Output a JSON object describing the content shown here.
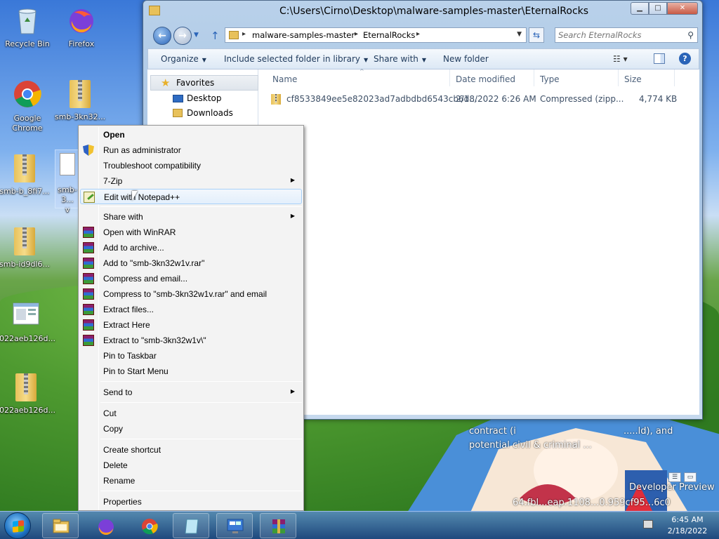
{
  "desktop": {
    "icons": [
      {
        "label": "Recycle Bin"
      },
      {
        "label": "Firefox"
      },
      {
        "label": "Google Chrome"
      },
      {
        "label": "smb-3kn32..."
      },
      {
        "label": "smb-b_8fi7..."
      },
      {
        "label": "smb-3..."
      },
      {
        "label": "v"
      },
      {
        "label": "smb-id9dl6..."
      },
      {
        "label": "022aeb126d..."
      },
      {
        "label": "022aeb126d..."
      }
    ],
    "wallpaper_text": [
      "contract (i",
      ".....ld), and",
      "potential civil & criminal ...",
      "Developer Preview",
      "64.fbl...eap.1108...0.959cf95...6c0"
    ]
  },
  "window": {
    "title": "C:\\Users\\Cirno\\Desktop\\malware-samples-master\\EternalRocks",
    "caption_buttons": {
      "minimize": "▁",
      "maximize": "□",
      "close": "✕"
    },
    "address": {
      "segments": [
        "malware-samples-master",
        "EternalRocks"
      ],
      "sep": "▸"
    },
    "search_placeholder": "Search EternalRocks",
    "toolbar": {
      "organize": "Organize",
      "include": "Include selected folder in library",
      "share": "Share with",
      "new_folder": "New folder"
    },
    "nav": {
      "favorites": "Favorites",
      "items": [
        "Desktop",
        "Downloads"
      ]
    },
    "columns": {
      "name": "Name",
      "date": "Date modified",
      "type": "Type",
      "size": "Size"
    },
    "files": [
      {
        "name": "cf8533849ee5e82023ad7adbdbd6543cb6d...",
        "date": "2/18/2022 6:26 AM",
        "type": "Compressed (zipp...",
        "size": "4,774 KB"
      }
    ]
  },
  "context_menu": {
    "items": [
      {
        "label": "Open",
        "bold": true
      },
      {
        "label": "Run as administrator",
        "icon": "shield-icon"
      },
      {
        "label": "Troubleshoot compatibility"
      },
      {
        "label": "7-Zip",
        "submenu": true
      },
      {
        "label": "Edit with Notepad++",
        "icon": "notepadpp-icon",
        "highlighted": true
      },
      {
        "label": "Share with",
        "submenu": true
      },
      {
        "label": "Open with WinRAR",
        "icon": "winrar-icon"
      },
      {
        "label": "Add to archive...",
        "icon": "winrar-icon"
      },
      {
        "label": "Add to \"smb-3kn32w1v.rar\"",
        "icon": "winrar-icon"
      },
      {
        "label": "Compress and email...",
        "icon": "winrar-icon"
      },
      {
        "label": "Compress to \"smb-3kn32w1v.rar\" and email",
        "icon": "winrar-icon"
      },
      {
        "label": "Extract files...",
        "icon": "winrar-icon"
      },
      {
        "label": "Extract Here",
        "icon": "winrar-icon"
      },
      {
        "label": "Extract to \"smb-3kn32w1v\\\"",
        "icon": "winrar-icon"
      },
      {
        "label": "Pin to Taskbar"
      },
      {
        "label": "Pin to Start Menu"
      },
      {
        "label": "Send to",
        "submenu": true
      },
      {
        "label": "Cut"
      },
      {
        "label": "Copy"
      },
      {
        "label": "Create shortcut"
      },
      {
        "label": "Delete"
      },
      {
        "label": "Rename"
      },
      {
        "label": "Properties"
      }
    ]
  },
  "taskbar": {
    "apps": [
      "explorer-icon",
      "firefox-icon",
      "chrome-icon",
      "notepad-icon",
      "remote-desktop-icon",
      "winrar-icon"
    ],
    "clock": {
      "time": "6:45 AM",
      "date": "2/18/2022"
    }
  }
}
